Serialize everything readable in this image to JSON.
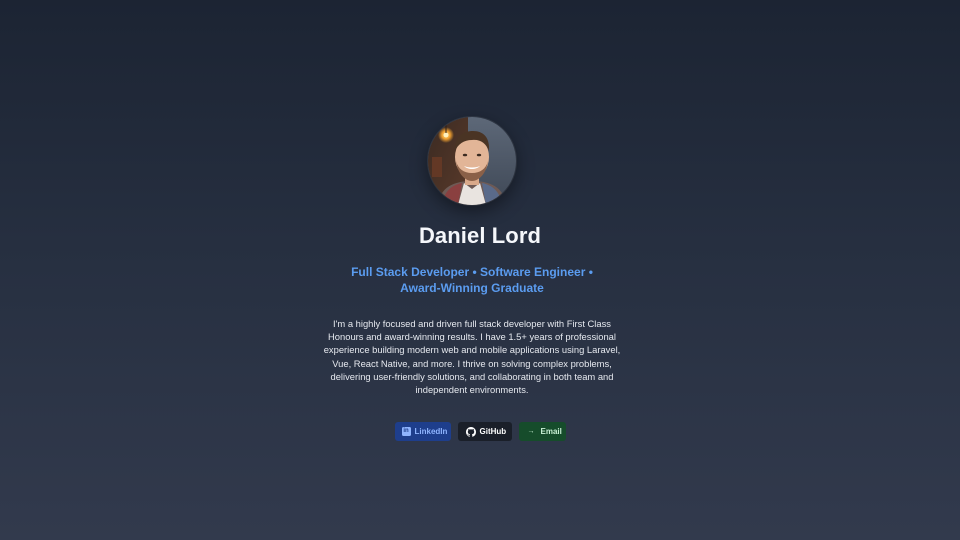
{
  "profile": {
    "avatar_alt": "Daniel Lord",
    "name": "Daniel Lord",
    "tagline": "Full Stack Developer • Software Engineer • Award-Winning Graduate",
    "bio": "I'm a highly focused and driven full stack developer with First Class Honours and award-winning results. I have 1.5+ years of professional experience building modern web and mobile applications using Laravel, Vue, React Native, and more. I thrive on solving complex problems, delivering user-friendly solutions, and collaborating in both team and independent environments."
  },
  "links": {
    "linkedin": {
      "label": "LinkedIn",
      "icon": "linkedin-icon",
      "icon_text": "in"
    },
    "github": {
      "label": "GitHub",
      "icon": "github-icon"
    },
    "email": {
      "label": "Email",
      "icon": "arrow-right-icon",
      "icon_text": "→"
    }
  },
  "colors": {
    "background_top": "#1c2433",
    "background_bottom": "#323a4d",
    "tagline": "#5b9cf0",
    "linkedin_bg": "#1e3e8c",
    "github_bg": "#1a1f29",
    "email_bg": "#164c2b"
  }
}
